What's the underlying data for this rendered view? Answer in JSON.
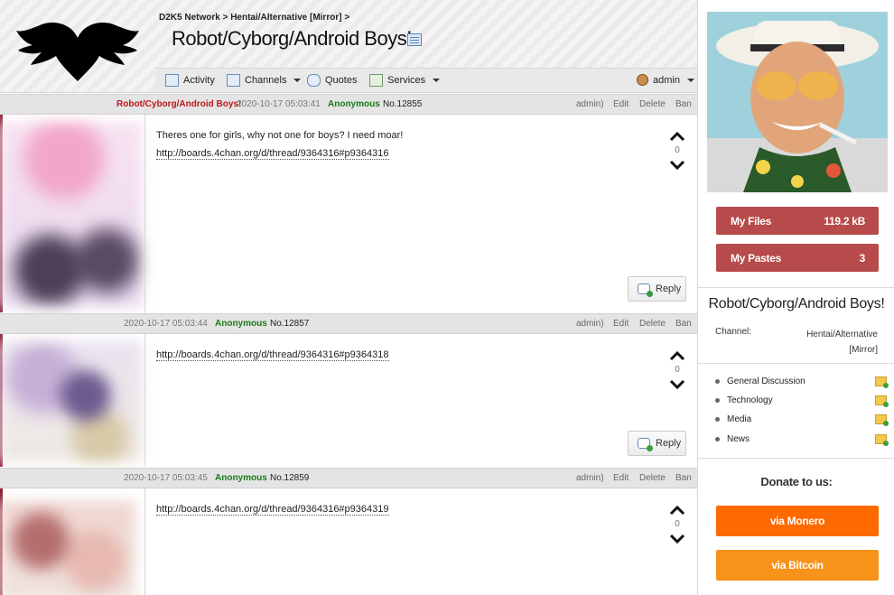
{
  "header": {
    "breadcrumb": "D2K5 Network > Hentai/Alternative [Mirror] >",
    "title": "Robot/Cyborg/Android Boys!",
    "nav": {
      "activity": "Activity",
      "channels": "Channels",
      "quotes": "Quotes",
      "services": "Services",
      "user": "admin"
    }
  },
  "posts": [
    {
      "thread_label": "Robot/Cyborg/Android Boys!",
      "date": "2020-10-17 05:03:41",
      "name": "Anonymous",
      "number": "No.12855",
      "actions": {
        "admin": "admin)",
        "edit": "Edit",
        "delete": "Delete",
        "ban": "Ban"
      },
      "text": "Theres one for girls, why not one for boys? I need moar!",
      "link": "http://boards.4chan.org/d/thread/9364316#p9364316",
      "votes": "0",
      "reply": "Reply"
    },
    {
      "date": "2020-10-17 05:03:44",
      "name": "Anonymous",
      "number": "No.12857",
      "actions": {
        "admin": "admin)",
        "edit": "Edit",
        "delete": "Delete",
        "ban": "Ban"
      },
      "link": "http://boards.4chan.org/d/thread/9364316#p9364318",
      "votes": "0",
      "reply": "Reply"
    },
    {
      "date": "2020-10-17 05:03:45",
      "name": "Anonymous",
      "number": "No.12859",
      "actions": {
        "admin": "admin)",
        "edit": "Edit",
        "delete": "Delete",
        "ban": "Ban"
      },
      "link": "http://boards.4chan.org/d/thread/9364316#p9364319",
      "votes": "0"
    }
  ],
  "sidebar": {
    "my_files": {
      "label": "My Files",
      "value": "119.2 kB"
    },
    "my_pastes": {
      "label": "My Pastes",
      "value": "3"
    },
    "thread_title": "Robot/Cyborg/Android Boys!",
    "channel_label": "Channel:",
    "channel_value": "Hentai/Alternative [Mirror]",
    "categories": [
      {
        "label": "General Discussion"
      },
      {
        "label": "Technology"
      },
      {
        "label": "Media"
      },
      {
        "label": "News"
      }
    ],
    "donate_title": "Donate to us:",
    "donate_monero": "via Monero",
    "donate_bitcoin": "via Bitcoin"
  },
  "colors": {
    "accent_red": "#b74a4a",
    "monero_orange": "#ff6a00",
    "bitcoin_orange": "#f7931a",
    "anon_green": "#1a7a1a",
    "thread_red": "#c0161d"
  }
}
